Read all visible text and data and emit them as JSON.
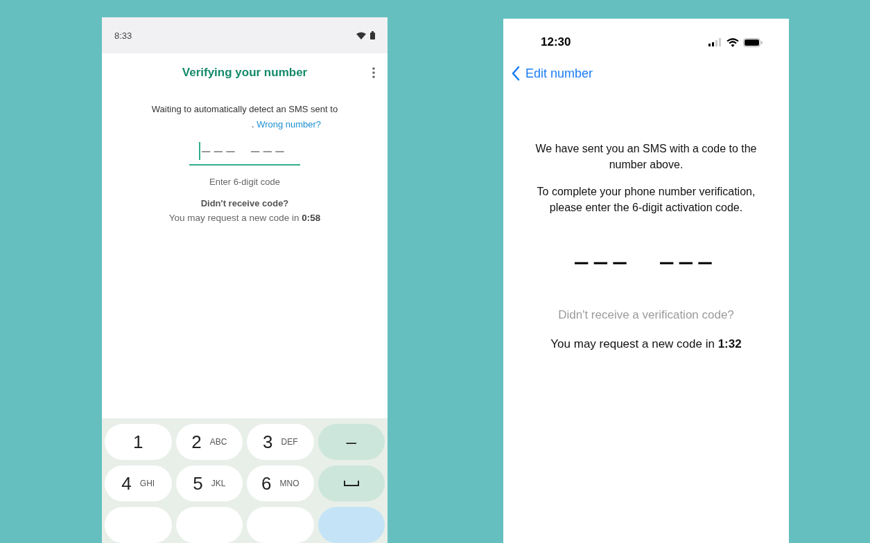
{
  "android": {
    "status_bar": {
      "time": "8:33"
    },
    "title": "Verifying your number",
    "message": "Waiting to automatically detect an SMS sent to",
    "number_suffix": ".",
    "wrong_number_link": "Wrong number?",
    "code_field": {
      "focused": true
    },
    "code_hint": "Enter 6-digit code",
    "resend_heading": "Didn't receive code?",
    "resend_timer": "You may request a new code in **0:58**",
    "keypad": [
      {
        "kind": "digit",
        "digit": "1"
      },
      {
        "kind": "digit",
        "digit": "2",
        "letters": "ABC"
      },
      {
        "kind": "digit",
        "digit": "3",
        "letters": "DEF"
      },
      {
        "kind": "action",
        "symbol": "–"
      },
      {
        "kind": "digit",
        "digit": "4",
        "letters": "GHI"
      },
      {
        "kind": "digit",
        "digit": "5",
        "letters": "JKL"
      },
      {
        "kind": "digit",
        "digit": "6",
        "letters": "MNO"
      },
      {
        "kind": "space"
      },
      {
        "kind": "blank"
      },
      {
        "kind": "blank"
      },
      {
        "kind": "blank"
      },
      {
        "kind": "enter"
      }
    ]
  },
  "ios": {
    "status_bar": {
      "time": "12:30"
    },
    "back_link": "Edit number",
    "message": "We have sent you an SMS with a code to the number above.",
    "instruction": "To complete your phone number verification, please enter the 6-digit activation code.",
    "resend_heading": "Didn't receive a verification code?",
    "resend_timer": "You may request a new code in **1:32**"
  }
}
